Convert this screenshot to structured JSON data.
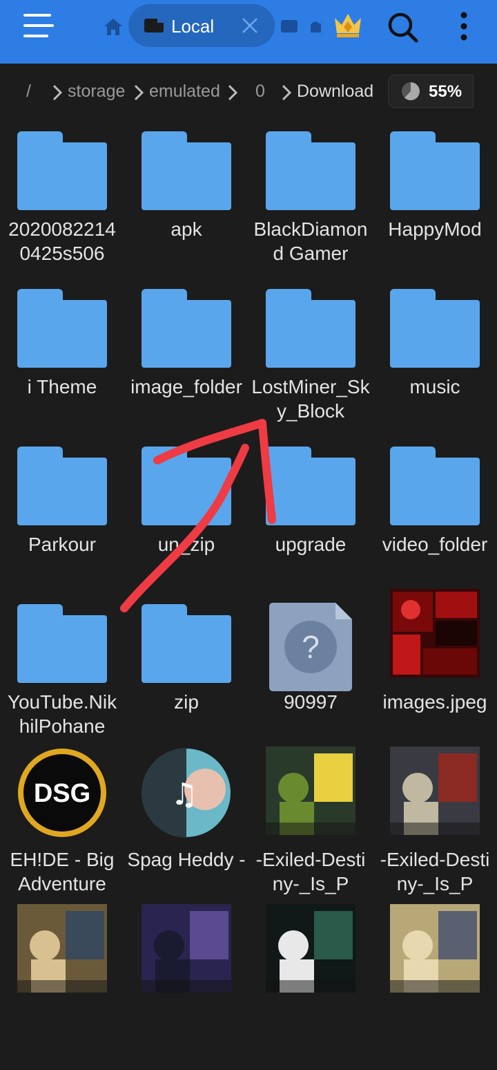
{
  "header": {
    "tab_label": "Local"
  },
  "breadcrumb": {
    "items": [
      "/",
      "storage",
      "emulated",
      "0",
      "Download"
    ],
    "usage_percent": "55%"
  },
  "files": [
    {
      "name": "2020082214 0425s506",
      "type": "folder"
    },
    {
      "name": "apk",
      "type": "folder"
    },
    {
      "name": "BlackDiamond Gamer",
      "type": "folder"
    },
    {
      "name": "HappyMod",
      "type": "folder"
    },
    {
      "name": "i Theme",
      "type": "folder"
    },
    {
      "name": "image_folder",
      "type": "folder"
    },
    {
      "name": "LostMiner_Sky_Block",
      "type": "folder"
    },
    {
      "name": "music",
      "type": "folder"
    },
    {
      "name": "Parkour",
      "type": "folder"
    },
    {
      "name": "un_zip",
      "type": "folder"
    },
    {
      "name": "upgrade",
      "type": "folder"
    },
    {
      "name": "video_folder",
      "type": "folder"
    },
    {
      "name": "YouTube.NikhilPohane",
      "type": "folder"
    },
    {
      "name": "zip",
      "type": "folder"
    },
    {
      "name": "90997",
      "type": "unknown"
    },
    {
      "name": "images.jpeg",
      "type": "image"
    },
    {
      "name": "EH!DE - Big Adventure",
      "type": "audio"
    },
    {
      "name": "Spag Heddy -",
      "type": "audio"
    },
    {
      "name": "-Exiled-Destiny-_Is_P",
      "type": "video"
    },
    {
      "name": "-Exiled-Destiny-_Is_P",
      "type": "video"
    },
    {
      "name": "",
      "type": "video"
    },
    {
      "name": "",
      "type": "video"
    },
    {
      "name": "",
      "type": "video"
    },
    {
      "name": "",
      "type": "video"
    }
  ],
  "colors": {
    "topbar": "#2d7de4",
    "folder": "#5aa6ec",
    "background": "#1c1c1c",
    "annotation": "#ef3b44"
  }
}
